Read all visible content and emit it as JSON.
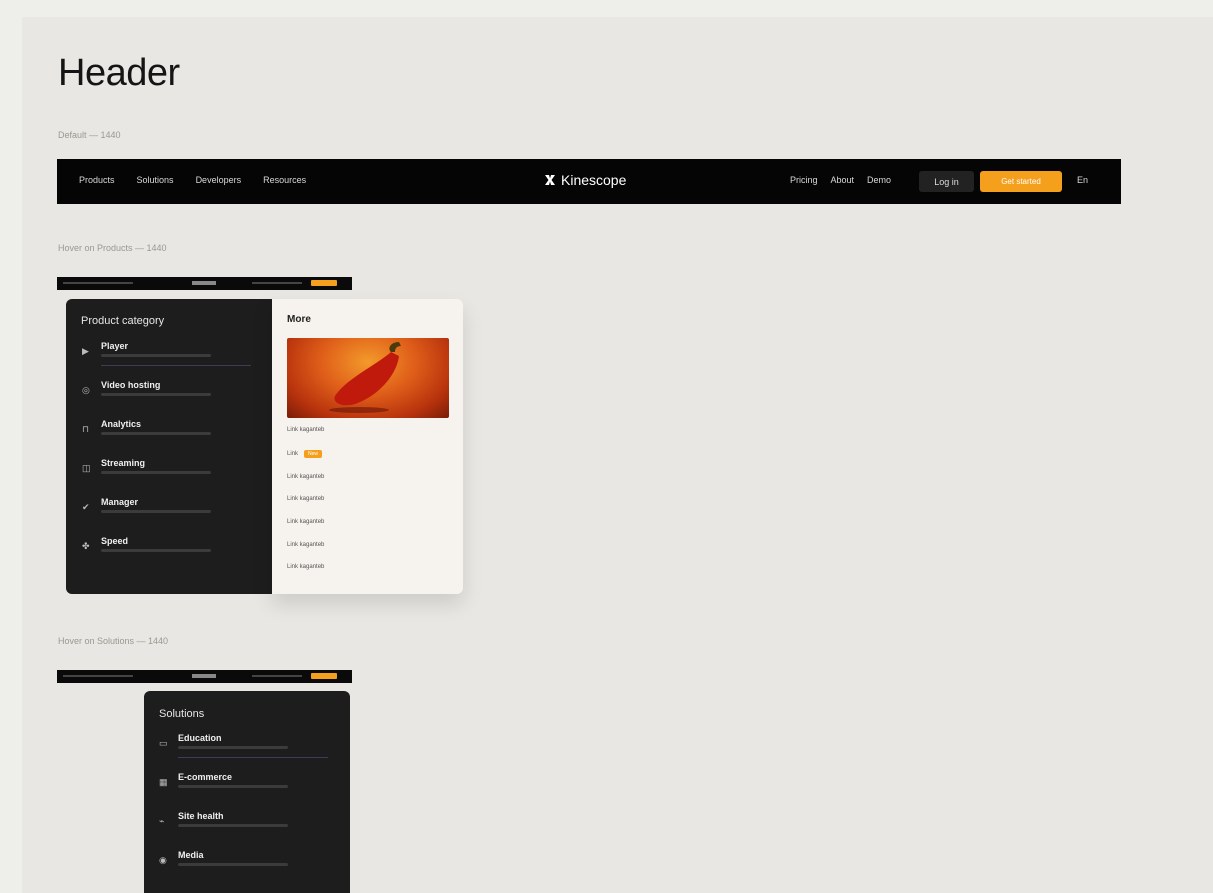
{
  "title": "Header",
  "captions": {
    "default": "Default — 1440",
    "hover_products": "Hover on Products — 1440",
    "hover_solutions": "Hover on Solutions — 1440"
  },
  "header": {
    "nav": [
      "Products",
      "Solutions",
      "Developers",
      "Resources"
    ],
    "logo": "Kinescope",
    "right_links": [
      "Pricing",
      "About",
      "Demo"
    ],
    "login": "Log in",
    "cta": "Get started",
    "lang": "En"
  },
  "products_menu": {
    "title": "Product category",
    "items": [
      {
        "icon": "▶",
        "label": "Player"
      },
      {
        "icon": "◎",
        "label": "Video hosting"
      },
      {
        "icon": "⊓",
        "label": "Analytics"
      },
      {
        "icon": "◫",
        "label": "Streaming"
      },
      {
        "icon": "✔",
        "label": "Manager"
      },
      {
        "icon": "✤",
        "label": "Speed"
      }
    ],
    "more_title": "More",
    "more_links": [
      {
        "label": "Link kaganteb",
        "badge": ""
      },
      {
        "label": "Link",
        "badge": "New"
      },
      {
        "label": "Link kaganteb",
        "badge": ""
      },
      {
        "label": "Link kaganteb",
        "badge": ""
      },
      {
        "label": "Link kaganteb",
        "badge": ""
      },
      {
        "label": "Link kaganteb",
        "badge": ""
      },
      {
        "label": "Link kaganteb",
        "badge": ""
      }
    ]
  },
  "solutions_menu": {
    "title": "Solutions",
    "items": [
      {
        "icon": "▭",
        "label": "Education"
      },
      {
        "icon": "▦",
        "label": "E-commerce"
      },
      {
        "icon": "⌁",
        "label": "Site health"
      },
      {
        "icon": "◉",
        "label": "Media"
      }
    ]
  },
  "colors": {
    "accent": "#f5a01c",
    "dark": "#1d1d1d",
    "header": "#050505"
  }
}
